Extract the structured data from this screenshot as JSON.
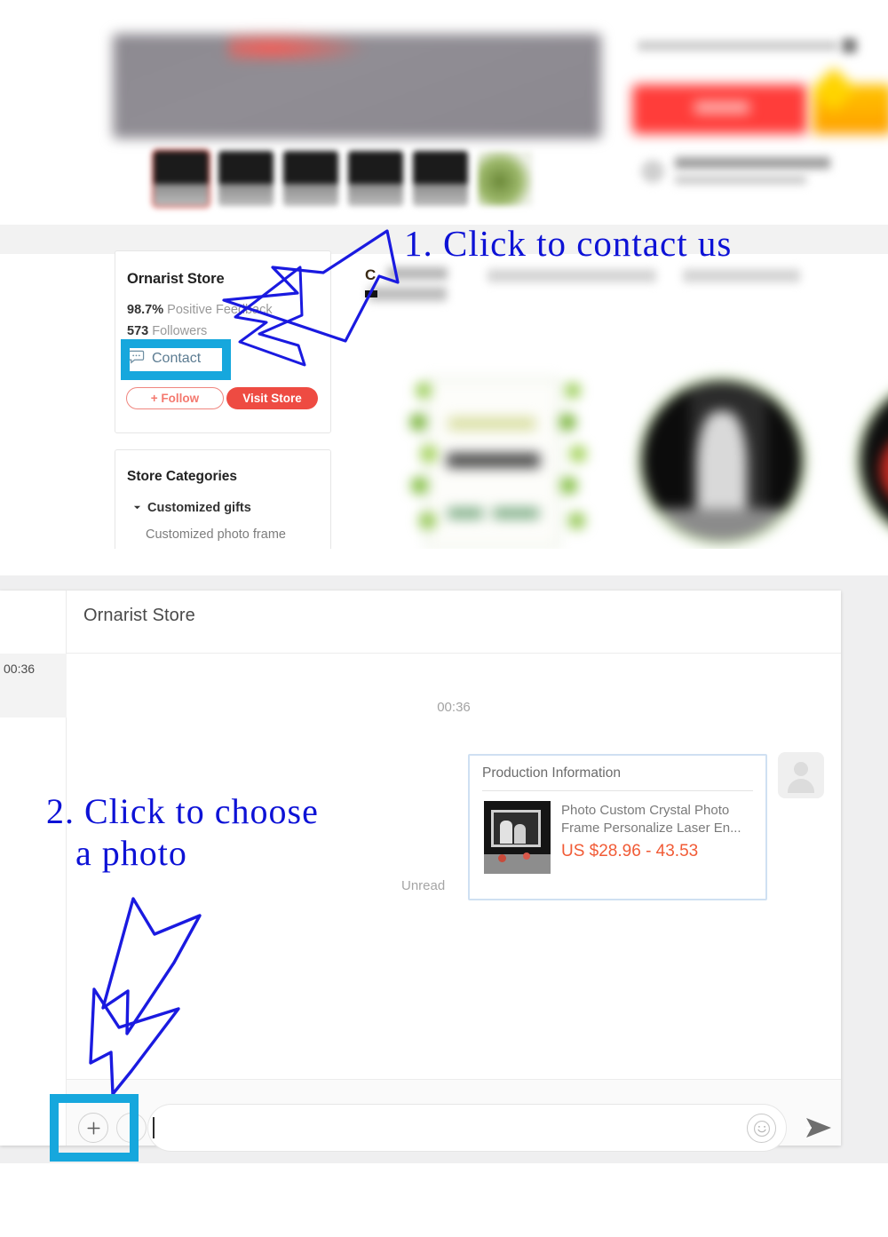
{
  "annotations": {
    "step1": "1. Click to contact us",
    "step2": "2. Click to choose\n   a photo",
    "highlight_color": "#16a7dd",
    "text_color": "#0d12d6"
  },
  "product_page": {
    "tabs": {
      "active_label_initial": "C",
      "tab_names_blurred": [
        "",
        "",
        ""
      ]
    },
    "seller_card": {
      "store_name": "Ornarist Store",
      "feedback_value": "98.7%",
      "feedback_label": "Positive Feedback",
      "followers_value": "573",
      "followers_label": "Followers",
      "contact_label": "Contact",
      "follow_label": "+ Follow",
      "visit_store_label": "Visit Store",
      "follow_color": "#f4796f",
      "visit_store_color": "#ee4b42"
    },
    "categories_card": {
      "title": "Store Categories",
      "items": [
        {
          "label": "Customized gifts",
          "expanded": true
        },
        {
          "label": "Customized photo frame",
          "expanded": false
        }
      ]
    }
  },
  "chat": {
    "header_title": "Ornarist Store",
    "sidebar_conversation_time": "00:36",
    "message_divider_time": "00:36",
    "unread_label": "Unread",
    "message_card": {
      "card_title": "Production Information",
      "product_name": "Photo Custom Crystal Photo Frame Personalize Laser En...",
      "price": "US $28.96 - 43.53",
      "price_color": "#f15b36",
      "border_color": "#cfe0f2"
    },
    "composer": {
      "plus_icon": "plus-icon",
      "emoji_icon": "smiley-icon",
      "send_icon": "send-arrow-icon",
      "input_value": "",
      "input_placeholder": ""
    }
  }
}
